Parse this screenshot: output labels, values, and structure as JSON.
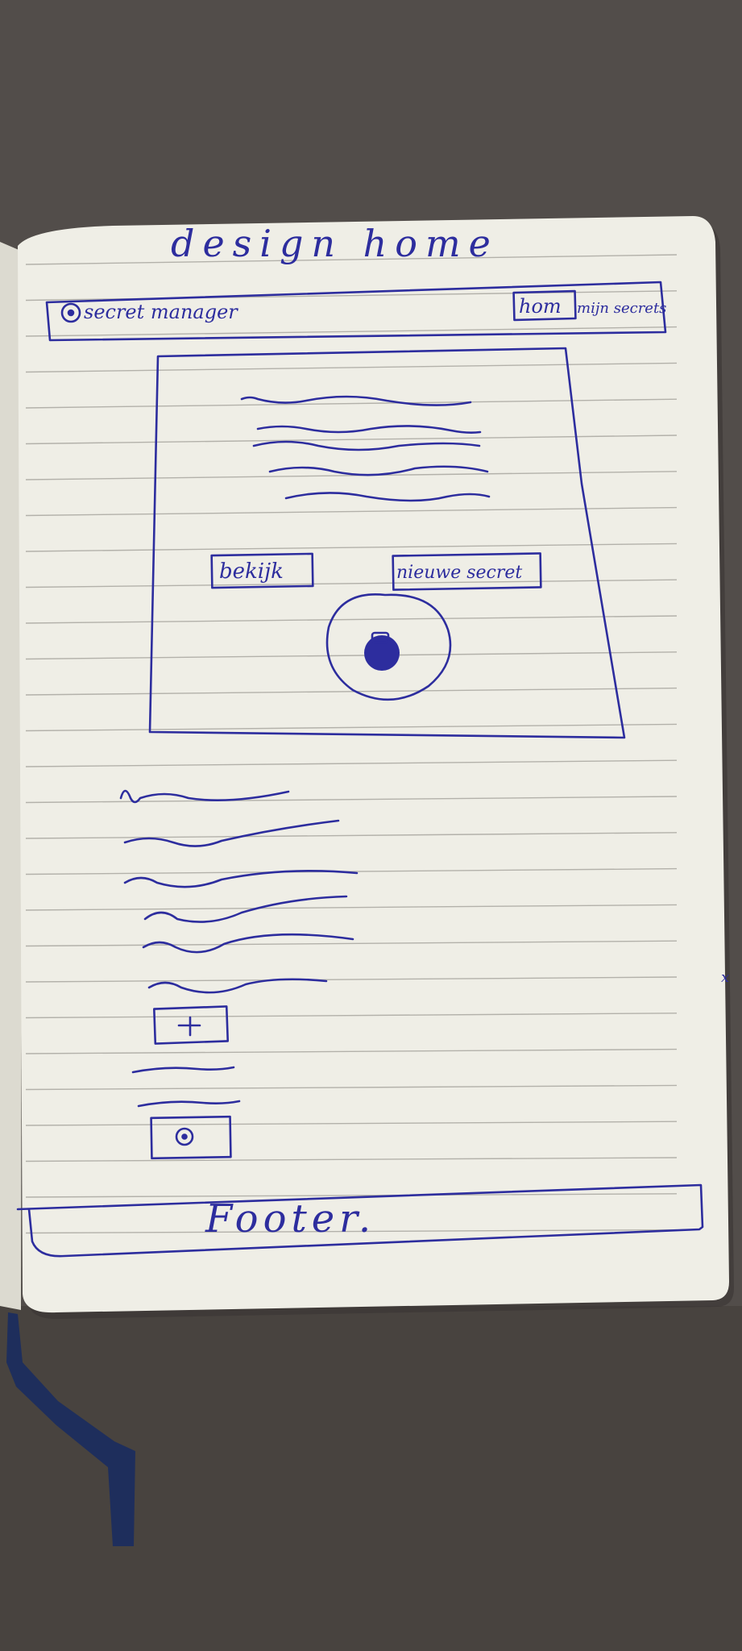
{
  "photo": {
    "subject": "notebook-sketch",
    "ink_color": "#2d2d9e",
    "paper_color": "#efeee6",
    "background_color": "#4e4a47"
  },
  "sketch": {
    "title": "design home",
    "navbar": {
      "brand": "secret manager",
      "brand_icon": "circle-logo-icon",
      "link_home": "hom",
      "link_secrets": "mijn secrets"
    },
    "hero": {
      "button_view": "bekijk",
      "button_new": "nieuwe secret",
      "icon": "lock-circle-icon"
    },
    "content": {
      "plus_box": "+",
      "circle_box_icon": "circle-dot-icon"
    },
    "footer": "Footer."
  },
  "margin_note": "x"
}
